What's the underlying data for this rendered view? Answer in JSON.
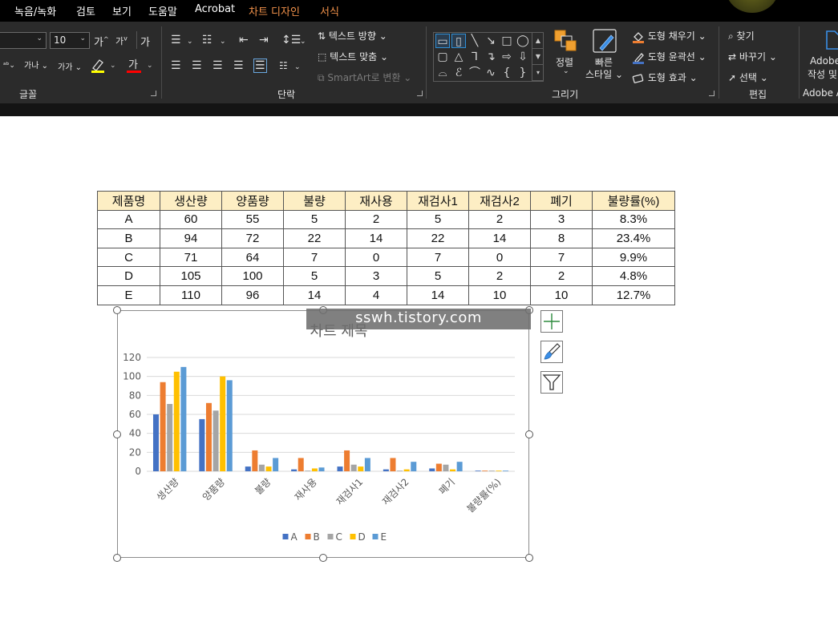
{
  "menu": {
    "items": [
      {
        "key": "record",
        "label": "녹음/녹화",
        "context": false
      },
      {
        "key": "review",
        "label": "검토",
        "context": false
      },
      {
        "key": "view",
        "label": "보기",
        "context": false
      },
      {
        "key": "help",
        "label": "도움말",
        "context": false
      },
      {
        "key": "acrobat",
        "label": "Acrobat",
        "context": false
      },
      {
        "key": "chart_design",
        "label": "차트 디자인",
        "context": true
      },
      {
        "key": "format",
        "label": "서식",
        "context": true
      }
    ]
  },
  "ribbon": {
    "font_group": {
      "label": "글꼴",
      "font_size": "10",
      "grow_label": "가",
      "shrink_label": "가",
      "clear_format_label": "가",
      "spacing_label": "가나",
      "case_label": "가가",
      "highlight_color": "#ffff00",
      "font_color": "#ff0000",
      "font_color_label": "가"
    },
    "paragraph_group": {
      "label": "단락",
      "text_direction_label": "텍스트 방향",
      "align_text_label": "텍스트 맞춤",
      "smartart_label": "SmartArt로 변환"
    },
    "drawing_group": {
      "label": "그리기",
      "arrange_label": "정렬",
      "quick_styles_line1": "빠른",
      "quick_styles_line2": "스타일",
      "shape_fill_label": "도형 채우기",
      "shape_outline_label": "도형 윤곽선",
      "shape_effects_label": "도형 효과"
    },
    "editing_group": {
      "label": "편집",
      "find_label": "찾기",
      "replace_label": "바꾸기",
      "select_label": "선택"
    },
    "adobe_group": {
      "label": "Adobe A",
      "line1": "Adobe",
      "line2": "작성 및"
    }
  },
  "table": {
    "headers": [
      "제품명",
      "생산량",
      "양품량",
      "불량",
      "재사용",
      "재검사1",
      "재검사2",
      "폐기",
      "불량률(%)"
    ],
    "rows": [
      [
        "A",
        "60",
        "55",
        "5",
        "2",
        "5",
        "2",
        "3",
        "8.3%"
      ],
      [
        "B",
        "94",
        "72",
        "22",
        "14",
        "22",
        "14",
        "8",
        "23.4%"
      ],
      [
        "C",
        "71",
        "64",
        "7",
        "0",
        "7",
        "0",
        "7",
        "9.9%"
      ],
      [
        "D",
        "105",
        "100",
        "5",
        "3",
        "5",
        "2",
        "2",
        "4.8%"
      ],
      [
        "E",
        "110",
        "96",
        "14",
        "4",
        "14",
        "10",
        "10",
        "12.7%"
      ]
    ]
  },
  "watermark": "sswh.tistory.com",
  "chart_data": {
    "type": "bar",
    "title": "차트 제목",
    "categories": [
      "생산량",
      "양품량",
      "불량",
      "재사용",
      "재검사1",
      "재검사2",
      "폐기",
      "불량률(%)"
    ],
    "series": [
      {
        "name": "A",
        "color": "#4472c4",
        "values": [
          60,
          55,
          5,
          2,
          5,
          2,
          3,
          0.083
        ]
      },
      {
        "name": "B",
        "color": "#ed7d31",
        "values": [
          94,
          72,
          22,
          14,
          22,
          14,
          8,
          0.234
        ]
      },
      {
        "name": "C",
        "color": "#a5a5a5",
        "values": [
          71,
          64,
          7,
          0,
          7,
          0,
          7,
          0.099
        ]
      },
      {
        "name": "D",
        "color": "#ffc000",
        "values": [
          105,
          100,
          5,
          3,
          5,
          2,
          2,
          0.048
        ]
      },
      {
        "name": "E",
        "color": "#5b9bd5",
        "values": [
          110,
          96,
          14,
          4,
          14,
          10,
          10,
          0.127
        ]
      }
    ],
    "yticks": [
      "0",
      "20",
      "40",
      "60",
      "80",
      "100",
      "120"
    ],
    "ylim": [
      0,
      120
    ],
    "grid": true,
    "legend": "bottom"
  }
}
